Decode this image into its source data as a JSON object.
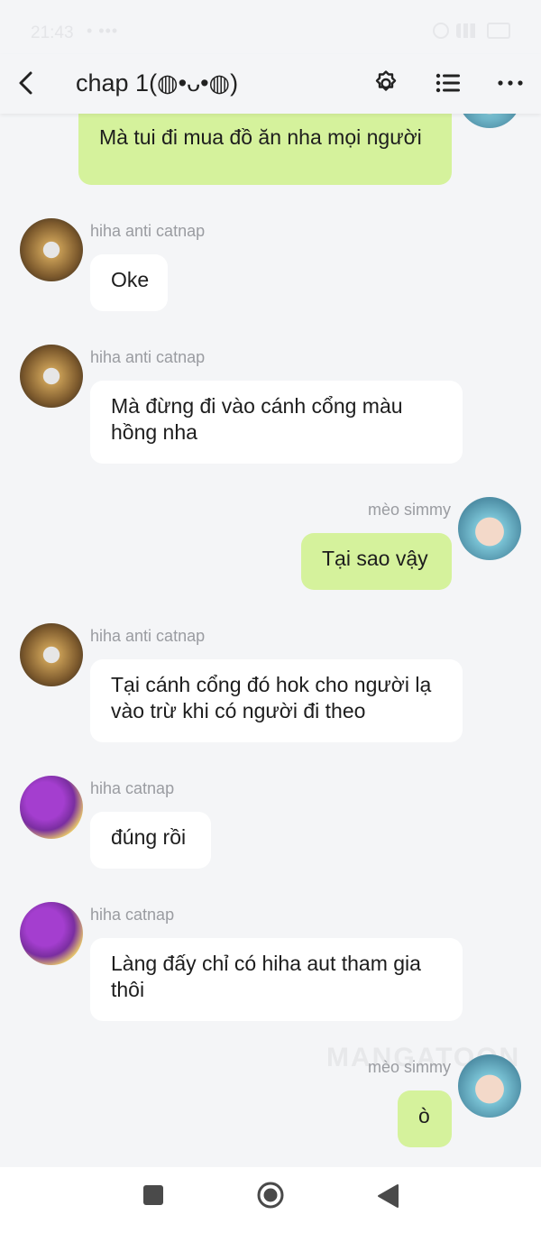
{
  "status_bar": {
    "time": "21:43",
    "extra": "• •••"
  },
  "header": {
    "title": "chap 1(◍•ᴗ•◍)"
  },
  "watermark": "MANGATOON",
  "messages": [
    {
      "sender": "",
      "side": "right",
      "text": "Mà tui đi mua đồ ăn nha mọi người"
    },
    {
      "sender": "hiha anti catnap",
      "side": "left",
      "text": "Oke"
    },
    {
      "sender": "hiha anti catnap",
      "side": "left",
      "text": "Mà đừng đi vào cánh cổng màu hồng nha"
    },
    {
      "sender": "mèo simmy",
      "side": "right",
      "text": "Tại sao vậy"
    },
    {
      "sender": "hiha anti catnap",
      "side": "left",
      "text": "Tại cánh cổng đó hok cho người lạ vào trừ khi có người đi theo"
    },
    {
      "sender": "hiha catnap",
      "side": "left",
      "text": "đúng rồi"
    },
    {
      "sender": "hiha catnap",
      "side": "left",
      "text": "Làng đấy chỉ có hiha aut tham gia thôi"
    },
    {
      "sender": "mèo simmy",
      "side": "right",
      "text": "ò"
    }
  ],
  "colors": {
    "left_bubble": "#ffffff",
    "right_bubble": "#d5f29c",
    "background": "#f4f5f7"
  }
}
